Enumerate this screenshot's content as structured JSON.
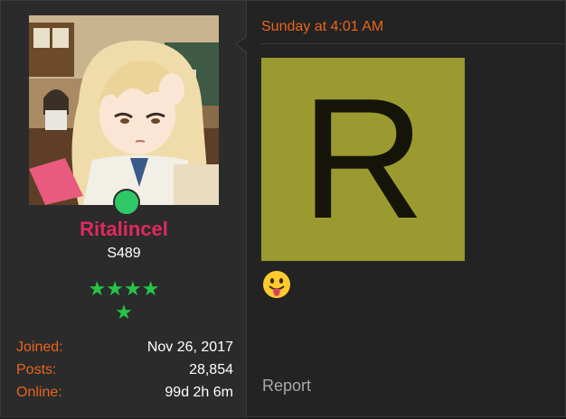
{
  "user": {
    "username": "Ritalincel",
    "title": "S489",
    "online": true,
    "stars_row1": "★★★★",
    "stars_row2": "★",
    "star_color": "#29c24a",
    "stats": [
      {
        "label": "Joined:",
        "value": "Nov 26, 2017"
      },
      {
        "label": "Posts:",
        "value": "28,854"
      },
      {
        "label": "Online:",
        "value": "99d 2h 6m"
      }
    ]
  },
  "post": {
    "date": "Sunday at 4:01 AM",
    "image_letter": "R",
    "image_bg": "#9a9a30",
    "emoji": "face-with-tongue",
    "report_label": "Report"
  },
  "colors": {
    "accent": "#e8651d",
    "username": "#e0295f",
    "online": "#2ec866"
  }
}
